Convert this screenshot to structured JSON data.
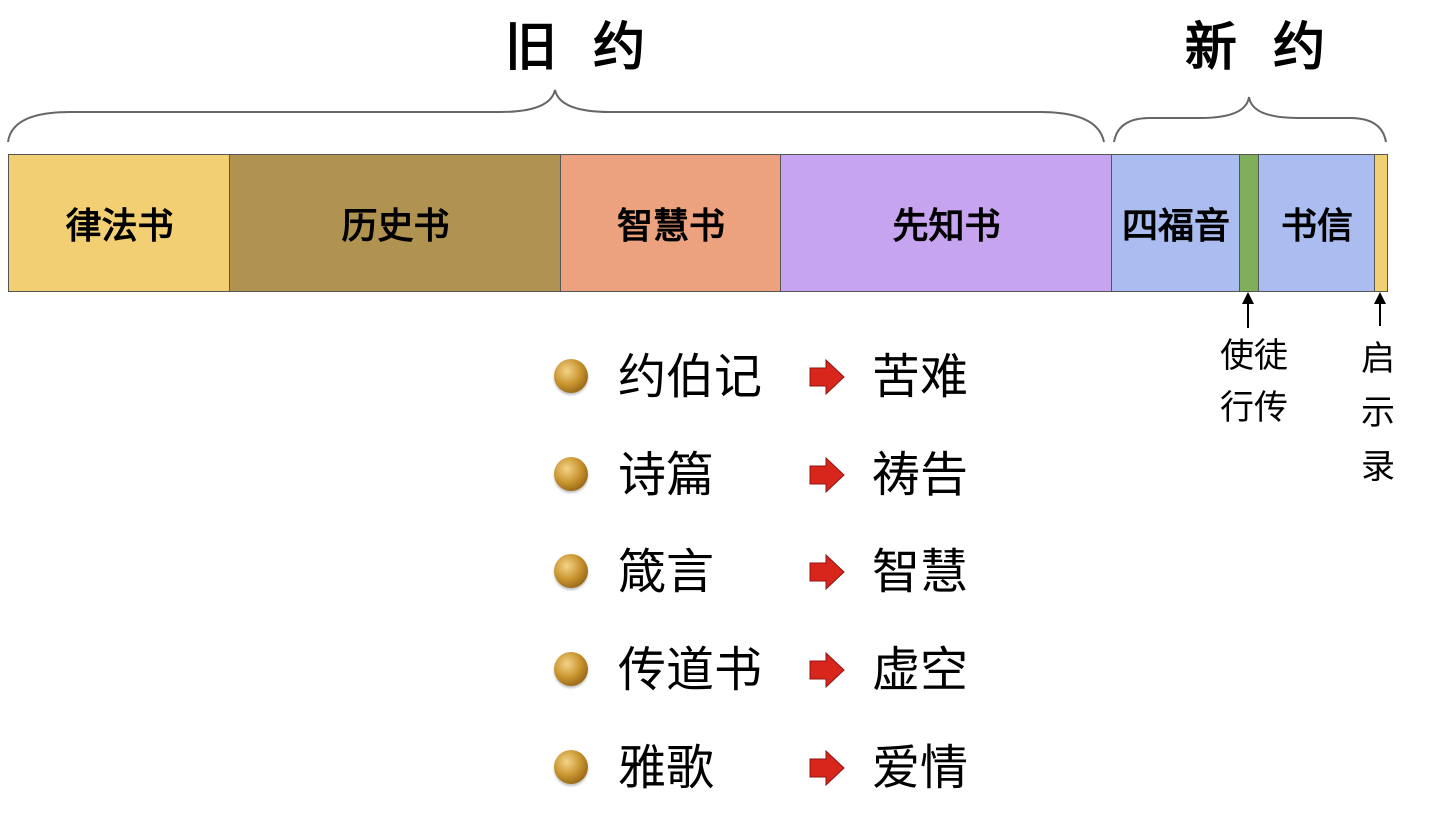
{
  "old_testament_title": "旧  约",
  "new_testament_title": "新  约",
  "bar_segments": [
    {
      "label": "律法书",
      "color": "#F2CF72"
    },
    {
      "label": "历史书",
      "color": "#B09350"
    },
    {
      "label": "智慧书",
      "color": "#ECA17F"
    },
    {
      "label": "先知书",
      "color": "#C7A4EF"
    },
    {
      "label": "四福音",
      "color": "#ABBDF0"
    },
    {
      "label": "",
      "color": "#7FAE5A"
    },
    {
      "label": "书信",
      "color": "#ABBDF0"
    },
    {
      "label": "",
      "color": "#F2CF72"
    }
  ],
  "acts_label": [
    "使徒",
    "行传"
  ],
  "revelation_label": [
    "启",
    "示",
    "录"
  ],
  "wisdom_books": [
    {
      "book": "约伯记",
      "theme": "苦难"
    },
    {
      "book": "诗篇",
      "theme": "祷告"
    },
    {
      "book": "箴言",
      "theme": "智慧"
    },
    {
      "book": "传道书",
      "theme": "虚空"
    },
    {
      "book": "雅歌",
      "theme": "爱情"
    }
  ]
}
